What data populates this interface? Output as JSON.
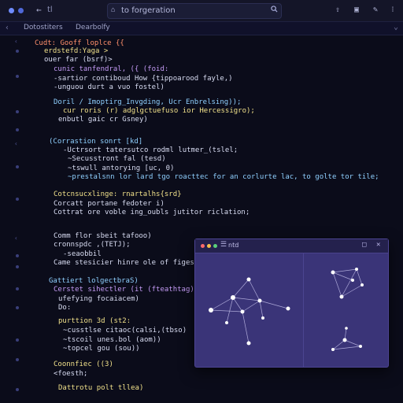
{
  "window": {
    "title": "tl"
  },
  "search": {
    "query": "to forgeration"
  },
  "tabs": [
    "Dotostiters",
    "Dearbolfy"
  ],
  "code_lines": [
    {
      "t": "Cudt: Gooff loplce {{",
      "c": "k",
      "i": 0
    },
    {
      "t": "erdstefd:Yaga >",
      "c": "f",
      "i": 2
    },
    {
      "t": "ouer far (bsrf)>",
      "c": "n",
      "i": 2
    },
    {
      "t": "cunic tanfendral, ({ (foid:",
      "c": "s",
      "i": 4
    },
    {
      "t": "-sartior contiboud How {tippoarood fayle,)",
      "c": "n",
      "i": 4
    },
    {
      "t": "-unguou durt a vuo fostel)",
      "c": "n",
      "i": 4
    },
    {
      "t": "Doril / Imoptirg_Invgding, Ucr Enbrelsing));",
      "c": "c",
      "i": 4
    },
    {
      "t": "cur roris (r) adglgctuefuso ior Hercessigro);",
      "c": "f",
      "i": 6
    },
    {
      "t": "enbutl gaic cr Gsney)",
      "c": "n",
      "i": 5
    },
    {
      "t": "(Corrastion sonrt [kd]",
      "c": "c",
      "i": 3
    },
    {
      "t": "-Uctrsort tatersutco rodml lutmer_(tslel;",
      "c": "n",
      "i": 6
    },
    {
      "t": "~Secusstront fal (tesd)",
      "c": "n",
      "i": 7
    },
    {
      "t": "~tswull antorying [uc, 0)",
      "c": "n",
      "i": 7
    },
    {
      "t": "~prestalsnn lor lard tgo roacttec for an corlurte lac, to golte tor tile;",
      "c": "c",
      "i": 7
    },
    {
      "t": "Cotcnsucxlinge: rnartalhs{srd}",
      "c": "f",
      "i": 4
    },
    {
      "t": "Corcatt portane fedoter i)",
      "c": "n",
      "i": 4
    },
    {
      "t": "Cottrat ore voble ing_oubls jutitor riclation;",
      "c": "n",
      "i": 4
    },
    {
      "t": "Comm flor sbeit tafooo)",
      "c": "n",
      "i": 4
    },
    {
      "t": "cronnspdc ,(TETJ);",
      "c": "n",
      "i": 4
    },
    {
      "t": "-seaobbil",
      "c": "n",
      "i": 6
    },
    {
      "t": "Came stesicier hinre ole of figes",
      "c": "n",
      "i": 4
    },
    {
      "t": "Gattiert lolgectbraS)",
      "c": "c",
      "i": 3
    },
    {
      "t": "Cerstet sihectler (it (fteathtag)",
      "c": "s",
      "i": 4
    },
    {
      "t": "ufefying focaiacem)",
      "c": "n",
      "i": 5
    },
    {
      "t": "Do:",
      "c": "n",
      "i": 5
    },
    {
      "t": "purttion 3d (st2:",
      "c": "f",
      "i": 5
    },
    {
      "t": "~cusstlse citaoc(calsi,(tbso)",
      "c": "n",
      "i": 6
    },
    {
      "t": "~tscoil unes.bol (aom))",
      "c": "n",
      "i": 6
    },
    {
      "t": "~topcel gou (sou))",
      "c": "n",
      "i": 6
    },
    {
      "t": "Coonnfiec ((3)",
      "c": "f",
      "i": 4
    },
    {
      "t": "<foesth;",
      "c": "n",
      "i": 4
    },
    {
      "t": "Dattrotu polt tllea)",
      "c": "f",
      "i": 5
    }
  ],
  "overlay": {
    "label": "ntd"
  },
  "colors": {
    "bg": "#0b0c1a",
    "accent": "#8fd0ff",
    "window": "#3a3478"
  },
  "icons": [
    "back-icon",
    "search-icon",
    "upload-icon",
    "share-icon",
    "pin-icon",
    "chevron-down-icon"
  ]
}
